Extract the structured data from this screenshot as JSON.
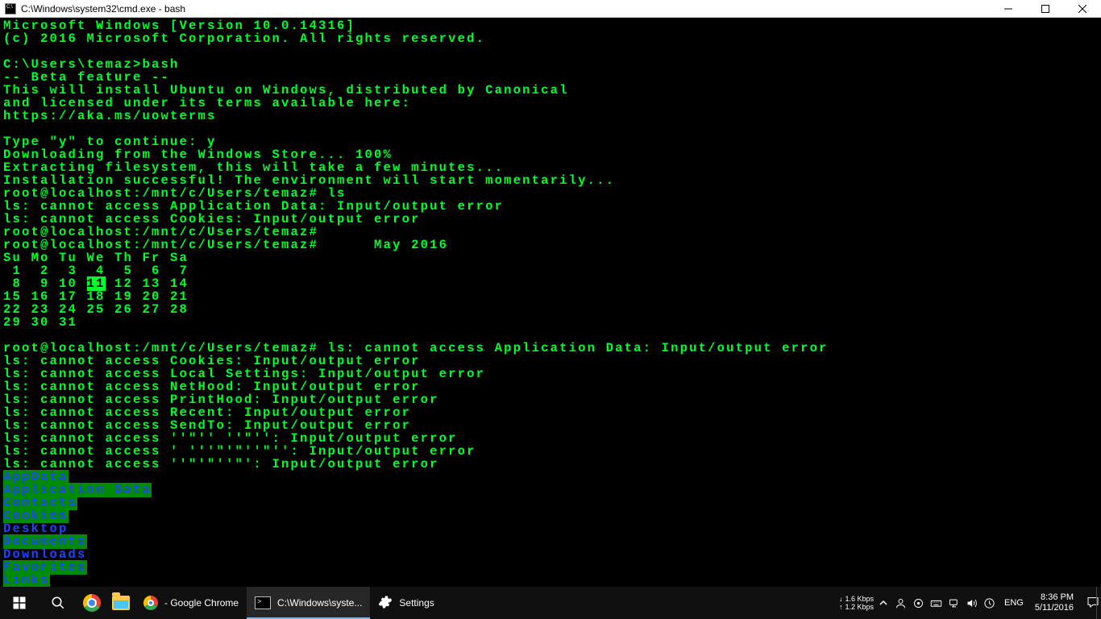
{
  "window": {
    "title": "C:\\Windows\\system32\\cmd.exe - bash"
  },
  "terminal": {
    "lines": [
      {
        "t": "Microsoft Windows [Version 10.0.14316]"
      },
      {
        "t": "(c) 2016 Microsoft Corporation. All rights reserved."
      },
      {
        "t": ""
      },
      {
        "t": "C:\\Users\\temaz>bash"
      },
      {
        "t": "-- Beta feature --"
      },
      {
        "t": "This will install Ubuntu on Windows, distributed by Canonical"
      },
      {
        "t": "and licensed under its terms available here:"
      },
      {
        "t": "https://aka.ms/uowterms"
      },
      {
        "t": ""
      },
      {
        "t": "Type \"y\" to continue: y"
      },
      {
        "t": "Downloading from the Windows Store... 100%"
      },
      {
        "t": "Extracting filesystem, this will take a few minutes..."
      },
      {
        "t": "Installation successful! The environment will start momentarily..."
      },
      {
        "t": "root@localhost:/mnt/c/Users/temaz# ls"
      },
      {
        "t": "ls: cannot access Application Data: Input/output error"
      },
      {
        "t": "ls: cannot access Cookies: Input/output error"
      },
      {
        "t": "root@localhost:/mnt/c/Users/temaz#"
      },
      {
        "t": "root@localhost:/mnt/c/Users/temaz#      May 2016"
      }
    ],
    "cal": {
      "head": "Su Mo Tu We Th Fr Sa",
      "w1": " 1  2  3  4  5  6  7",
      "w2a": " 8  9 10 ",
      "w2today": "11",
      "w2b": " 12 13 14",
      "w3": "15 16 17 18 19 20 21",
      "w4": "22 23 24 25 26 27 28",
      "w5": "29 30 31"
    },
    "after": [
      {
        "t": ""
      },
      {
        "t": "root@localhost:/mnt/c/Users/temaz# ls: cannot access Application Data: Input/output error"
      },
      {
        "t": "ls: cannot access Cookies: Input/output error"
      },
      {
        "t": "ls: cannot access Local Settings: Input/output error"
      },
      {
        "t": "ls: cannot access NetHood: Input/output error"
      },
      {
        "t": "ls: cannot access PrintHood: Input/output error"
      },
      {
        "t": "ls: cannot access Recent: Input/output error"
      },
      {
        "t": "ls: cannot access SendTo: Input/output error"
      },
      {
        "t": "ls: cannot access ''\"'' ''\"'': Input/output error"
      },
      {
        "t": "ls: cannot access ' '''\"'\"''\"'': Input/output error"
      },
      {
        "t": "ls: cannot access ''\"'\"''\"': Input/output error"
      }
    ],
    "dirs": [
      {
        "name": "AppData",
        "cls": "bluehl"
      },
      {
        "name": "Application Data",
        "cls": "bluehl"
      },
      {
        "name": "Contacts",
        "cls": "bluehl"
      },
      {
        "name": "Cookies",
        "cls": "bluehl"
      },
      {
        "name": "Desktop",
        "cls": "blue"
      },
      {
        "name": "Documents",
        "cls": "bluehl"
      },
      {
        "name": "Downloads",
        "cls": "blue"
      },
      {
        "name": "Favorites",
        "cls": "bluehl"
      },
      {
        "name": "Links",
        "cls": "bluehl"
      }
    ]
  },
  "taskbar": {
    "chromeGroup": " - Google Chrome",
    "cmdGroup": "C:\\Windows\\syste...",
    "settings": "Settings",
    "net_down": "1.6 Kbps",
    "net_up": "1.2 Kbps",
    "lang": "ENG",
    "time": "8:36 PM",
    "date": "5/11/2016"
  }
}
